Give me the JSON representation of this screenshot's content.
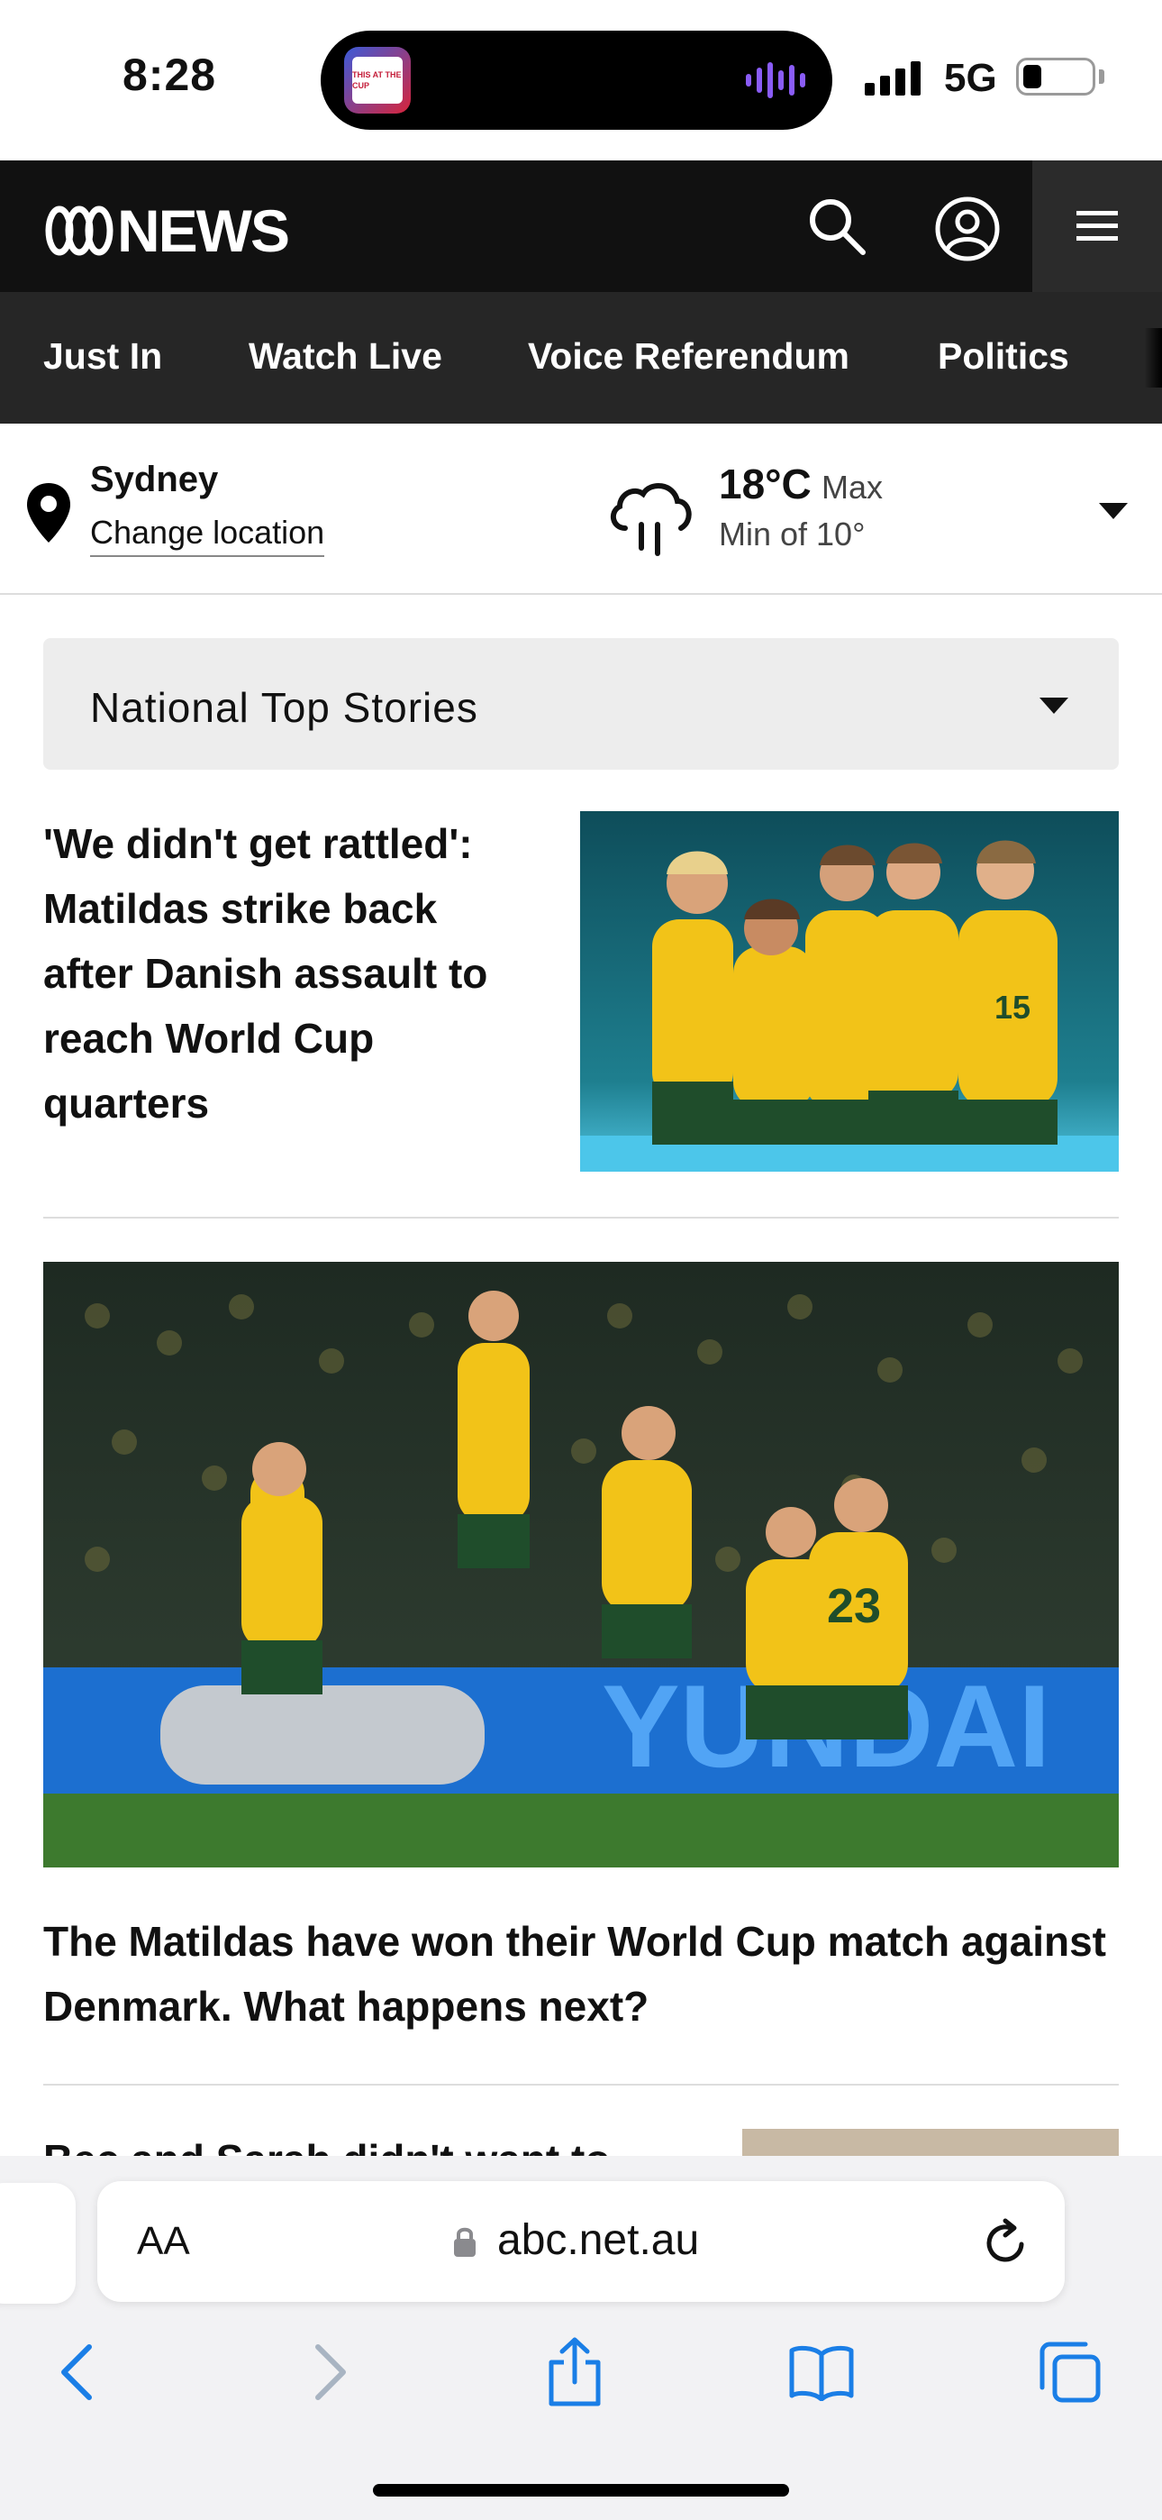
{
  "status_bar": {
    "time": "8:28",
    "network": "5G",
    "live_activity_app": "THIS AT THE CUP"
  },
  "header": {
    "logo_text": "NEWS",
    "icons": [
      "search-icon",
      "account-icon",
      "menu-icon"
    ]
  },
  "nav": {
    "items": [
      {
        "label": "Just In"
      },
      {
        "label": "Watch Live"
      },
      {
        "label": "Voice Referendum"
      },
      {
        "label": "Politics"
      }
    ]
  },
  "weather": {
    "city": "Sydney",
    "change_location": "Change location",
    "max_temp": "18°C",
    "max_label": "Max",
    "min_text": "Min of 10°",
    "condition_icon": "rain-cloud-icon"
  },
  "section_select": {
    "label": "National Top Stories"
  },
  "stories": [
    {
      "title": "'We didn't get rattled': Matildas strike back after Danish assault to reach World Cup quarters"
    },
    {
      "title": "The Matildas have won their World Cup match against Denmark. What happens next?"
    },
    {
      "title": "Bec and Sarah didn't want to"
    }
  ],
  "browser": {
    "aa_label": "AA",
    "url": "abc.net.au"
  },
  "colors": {
    "header_bg": "#111111",
    "nav_bg": "#262626",
    "link_blue": "#1a7ee6",
    "jersey_yellow": "#f2c318",
    "jersey_green": "#1f4d2b"
  }
}
